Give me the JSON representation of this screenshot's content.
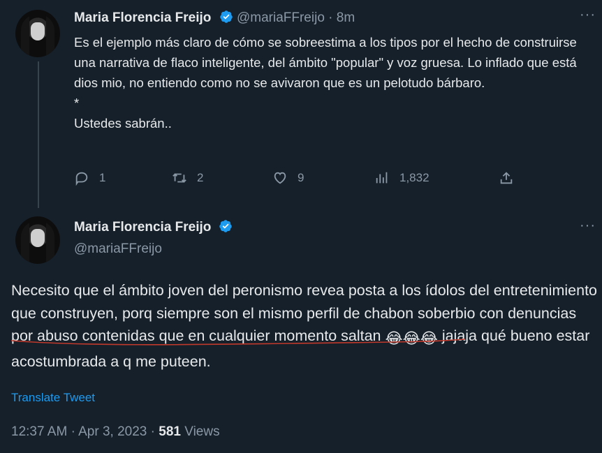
{
  "tweet1": {
    "author_name": "Maria Florencia Freijo",
    "handle": "@mariaFFreijo",
    "time": "8m",
    "separator": "·",
    "text": "Es el ejemplo más claro de cómo se sobreestima a los tipos por el hecho de construirse una narrativa de flaco inteligente, del ámbito \"popular\" y voz gruesa. Lo inflado que está dios mio, no entiendo como no se avivaron que es un pelotudo bárbaro.\n*\nUstedes sabrán..",
    "replies": "1",
    "retweets": "2",
    "likes": "9",
    "views": "1,832"
  },
  "tweet2": {
    "author_name": "Maria Florencia Freijo",
    "handle": "@mariaFFreijo",
    "text_part1": "Necesito que el ámbito joven del peronismo revea posta a los ídolos del entretenimiento que construyen, porq siempre son el mismo perfil de chabon soberbio con denuncias por abuso contenidas que en cualquier momento saltan ",
    "emojis": "😂😂😂",
    "text_part2": " jajaja qué bueno estar acostumbrada a q me puteen.",
    "translate_label": "Translate Tweet",
    "time": "12:37 AM",
    "date": "Apr 3, 2023",
    "separator": "·",
    "views_count": "581",
    "views_label": "Views"
  },
  "icons": {
    "more": "more-icon",
    "verified": "verified-badge-icon",
    "reply": "reply-icon",
    "retweet": "retweet-icon",
    "like": "heart-icon",
    "views": "analytics-icon",
    "share": "share-icon"
  },
  "colors": {
    "background": "#15202b",
    "text": "#e7e9ea",
    "muted": "#8b98a5",
    "accent": "#1d9bf0"
  }
}
